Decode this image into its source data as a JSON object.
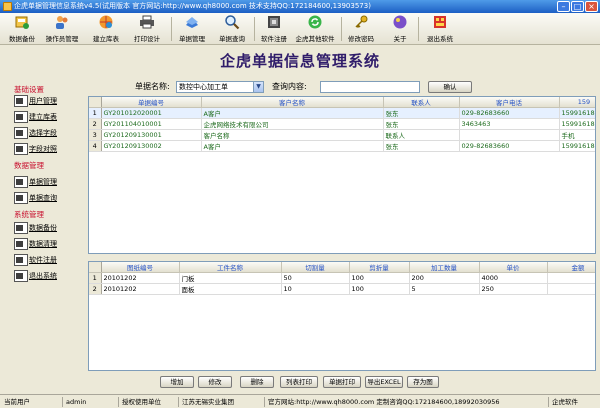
{
  "window": {
    "title": "企虎单据管理信息系统v4.5(试用版本 官方网站:http://www.qh8000.com 技术支持QQ:172184600,13903573)"
  },
  "toolbar": {
    "items": [
      {
        "label": "数据备份",
        "icon": "database-backup-icon"
      },
      {
        "label": "操作员管理",
        "icon": "users-icon"
      },
      {
        "label": "建立库表",
        "icon": "globe-table-icon"
      },
      {
        "label": "打印设计",
        "icon": "printer-icon"
      },
      {
        "label": "单据管理",
        "icon": "document-stack-icon"
      },
      {
        "label": "单据查询",
        "icon": "magnifier-icon"
      },
      {
        "label": "软件注册",
        "icon": "register-icon"
      },
      {
        "label": "企虎其他软件",
        "icon": "refresh-arrows-icon"
      },
      {
        "label": "修改密码",
        "icon": "key-icon"
      },
      {
        "label": "关于",
        "icon": "info-icon"
      },
      {
        "label": "退出系统",
        "icon": "exit-icon"
      }
    ]
  },
  "header": {
    "title": "企虎单据信息管理系统"
  },
  "search": {
    "doc_label": "单据名称:",
    "doc_value": "数控中心加工单",
    "content_label": "查询内容:",
    "content_value": "",
    "confirm": "确认"
  },
  "sidebar": {
    "sections": [
      {
        "title": "基础设置",
        "items": [
          "用户管理",
          "建立库表",
          "选择字段",
          "字段对照"
        ]
      },
      {
        "title": "数据管理",
        "items": [
          "单据管理",
          "单据查询"
        ]
      },
      {
        "title": "系统管理",
        "items": [
          "数据备份",
          "数据清理",
          "软件注册",
          "退出系统"
        ]
      }
    ]
  },
  "top_grid": {
    "columns": [
      "单据编号",
      "客户名称",
      "联系人",
      "客户电话",
      "159"
    ],
    "rows": [
      [
        "1",
        "GY201012020001",
        "A客户",
        "张东",
        "029-82683660",
        "15991618"
      ],
      [
        "2",
        "GY201104010001",
        "企虎网络技术有限公司",
        "张东",
        "3463463",
        "15991618"
      ],
      [
        "3",
        "GY201209130001",
        "客户名称",
        "联系人",
        "",
        "手机"
      ],
      [
        "4",
        "GY201209130002",
        "A客户",
        "张东",
        "029-82683660",
        "15991618"
      ]
    ]
  },
  "bottom_grid": {
    "columns": [
      "图纸编号",
      "工件名称",
      "切割量",
      "剪折量",
      "加工数量",
      "单价",
      "金额"
    ],
    "rows": [
      [
        "1",
        "20101202",
        "门板",
        "50",
        "100",
        "200",
        "4000",
        ""
      ],
      [
        "2",
        "20101202",
        "面板",
        "10",
        "100",
        "5",
        "250",
        ""
      ]
    ]
  },
  "actions": {
    "add": "增加",
    "edit": "修改",
    "delete": "删除",
    "list_print": "列表打印",
    "doc_print": "单据打印",
    "export_excel": "导出EXCEL",
    "save_as": "存为图"
  },
  "status": {
    "user_label": "当前用户",
    "user_value": "admin",
    "unit_label": "授权使用单位",
    "unit_value": "江苏无锡实业集团",
    "site": "官方网站:http://www.qh8000.com 定制咨询QQ:172184600,18992030956",
    "product": "企虎软件"
  }
}
